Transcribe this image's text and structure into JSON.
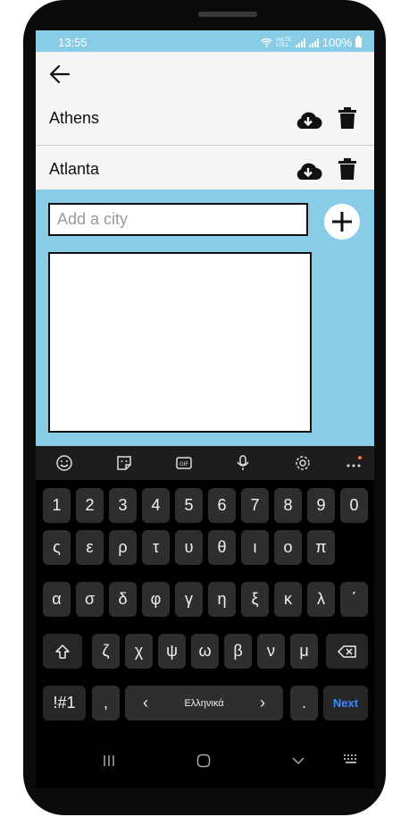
{
  "status": {
    "time": "13:55",
    "volte_top": "VoLTE",
    "volte_bottom": "LTE1",
    "battery": "100%"
  },
  "cities": [
    {
      "name": "Athens"
    },
    {
      "name": "Atlanta"
    }
  ],
  "add_city": {
    "placeholder": "Add a city"
  },
  "keyboard": {
    "row1": [
      "1",
      "2",
      "3",
      "4",
      "5",
      "6",
      "7",
      "8",
      "9",
      "0"
    ],
    "row2": [
      "ς",
      "ε",
      "ρ",
      "τ",
      "υ",
      "θ",
      "ι",
      "ο",
      "π"
    ],
    "row3": [
      "α",
      "σ",
      "δ",
      "φ",
      "γ",
      "η",
      "ξ",
      "κ",
      "λ",
      "΄"
    ],
    "row4": [
      "ζ",
      "χ",
      "ψ",
      "ω",
      "β",
      "ν",
      "μ"
    ],
    "symbols": "!#1",
    "comma": ",",
    "left_arrow": "‹",
    "language": "Ελληνικά",
    "right_arrow": "›",
    "period": ".",
    "next": "Next"
  },
  "colors": {
    "accent": "#89cce6",
    "keyboard_bg": "#000000",
    "key": "#2e2e2e",
    "next": "#3f8bff"
  }
}
